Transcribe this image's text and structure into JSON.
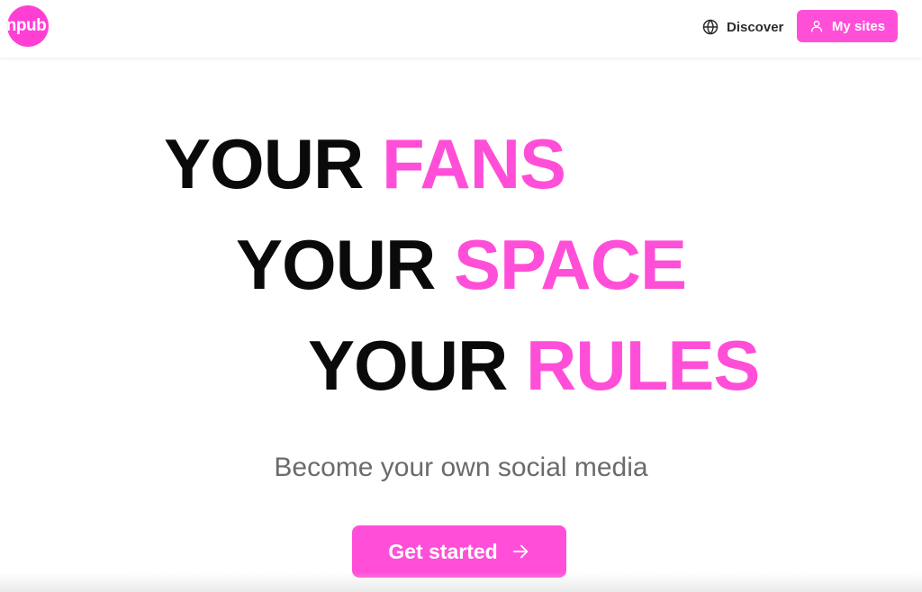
{
  "header": {
    "logo_text": "npub",
    "discover_label": "Discover",
    "mysites_label": "My sites"
  },
  "hero": {
    "lines": [
      {
        "lead": "YOUR",
        "highlight": "FANS"
      },
      {
        "lead": "YOUR",
        "highlight": "SPACE"
      },
      {
        "lead": "YOUR",
        "highlight": "RULES"
      }
    ],
    "subtitle": "Become your own social media",
    "cta_label": "Get started"
  },
  "icons": {
    "discover": "globe-icon",
    "mysites": "user-icon",
    "cta": "arrow-right-icon"
  },
  "colors": {
    "accent": "#ff4fd8",
    "text_dark": "#0a0a0a",
    "text_muted": "#6b6b6b"
  }
}
